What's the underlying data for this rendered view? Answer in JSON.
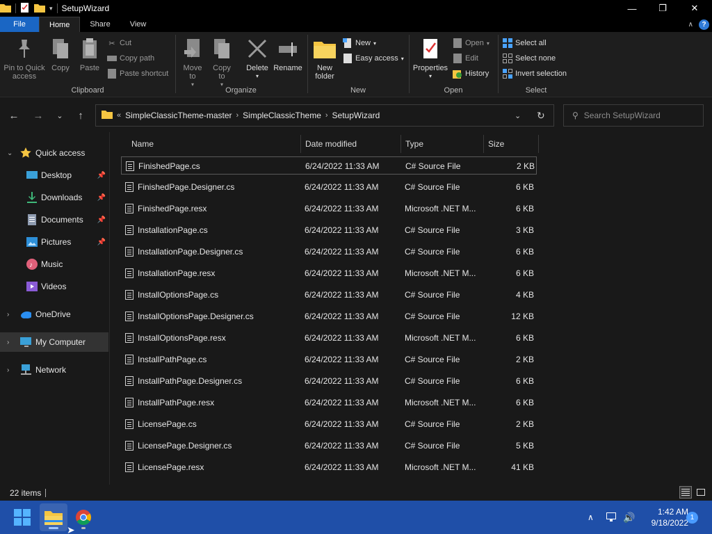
{
  "window": {
    "title": "SetupWizard",
    "controls": {
      "minimize": "—",
      "maximize": "❐",
      "close": "✕"
    }
  },
  "ribbon_tabs": [
    "File",
    "Home",
    "Share",
    "View"
  ],
  "ribbon": {
    "clipboard": {
      "label": "Clipboard",
      "pin": "Pin to Quick access",
      "copy": "Copy",
      "paste": "Paste",
      "cut": "Cut",
      "copy_path": "Copy path",
      "paste_shortcut": "Paste shortcut"
    },
    "organize": {
      "label": "Organize",
      "move_to": "Move to",
      "copy_to": "Copy to",
      "delete": "Delete",
      "rename": "Rename"
    },
    "new": {
      "label": "New",
      "new_folder": "New folder",
      "new_item": "New",
      "easy_access": "Easy access"
    },
    "open": {
      "label": "Open",
      "properties": "Properties",
      "open": "Open",
      "edit": "Edit",
      "history": "History"
    },
    "select": {
      "label": "Select",
      "select_all": "Select all",
      "select_none": "Select none",
      "invert_selection": "Invert selection"
    }
  },
  "address": {
    "overflow": "«",
    "crumbs": [
      "SimpleClassicTheme-master",
      "SimpleClassicTheme",
      "SetupWizard"
    ],
    "search_placeholder": "Search SetupWizard"
  },
  "nav_pane": {
    "quick_access": "Quick access",
    "items": [
      "Desktop",
      "Downloads",
      "Documents",
      "Pictures",
      "Music",
      "Videos"
    ],
    "onedrive": "OneDrive",
    "my_computer": "My Computer",
    "network": "Network"
  },
  "columns": {
    "name": "Name",
    "date": "Date modified",
    "type": "Type",
    "size": "Size"
  },
  "files": [
    {
      "name": "FinishedPage.cs",
      "date": "6/24/2022 11:33 AM",
      "type": "C# Source File",
      "size": "2 KB"
    },
    {
      "name": "FinishedPage.Designer.cs",
      "date": "6/24/2022 11:33 AM",
      "type": "C# Source File",
      "size": "6 KB"
    },
    {
      "name": "FinishedPage.resx",
      "date": "6/24/2022 11:33 AM",
      "type": "Microsoft .NET M...",
      "size": "6 KB"
    },
    {
      "name": "InstallationPage.cs",
      "date": "6/24/2022 11:33 AM",
      "type": "C# Source File",
      "size": "3 KB"
    },
    {
      "name": "InstallationPage.Designer.cs",
      "date": "6/24/2022 11:33 AM",
      "type": "C# Source File",
      "size": "6 KB"
    },
    {
      "name": "InstallationPage.resx",
      "date": "6/24/2022 11:33 AM",
      "type": "Microsoft .NET M...",
      "size": "6 KB"
    },
    {
      "name": "InstallOptionsPage.cs",
      "date": "6/24/2022 11:33 AM",
      "type": "C# Source File",
      "size": "4 KB"
    },
    {
      "name": "InstallOptionsPage.Designer.cs",
      "date": "6/24/2022 11:33 AM",
      "type": "C# Source File",
      "size": "12 KB"
    },
    {
      "name": "InstallOptionsPage.resx",
      "date": "6/24/2022 11:33 AM",
      "type": "Microsoft .NET M...",
      "size": "6 KB"
    },
    {
      "name": "InstallPathPage.cs",
      "date": "6/24/2022 11:33 AM",
      "type": "C# Source File",
      "size": "2 KB"
    },
    {
      "name": "InstallPathPage.Designer.cs",
      "date": "6/24/2022 11:33 AM",
      "type": "C# Source File",
      "size": "6 KB"
    },
    {
      "name": "InstallPathPage.resx",
      "date": "6/24/2022 11:33 AM",
      "type": "Microsoft .NET M...",
      "size": "6 KB"
    },
    {
      "name": "LicensePage.cs",
      "date": "6/24/2022 11:33 AM",
      "type": "C# Source File",
      "size": "2 KB"
    },
    {
      "name": "LicensePage.Designer.cs",
      "date": "6/24/2022 11:33 AM",
      "type": "C# Source File",
      "size": "5 KB"
    },
    {
      "name": "LicensePage.resx",
      "date": "6/24/2022 11:33 AM",
      "type": "Microsoft .NET M...",
      "size": "41 KB"
    }
  ],
  "status": {
    "item_count": "22 items"
  },
  "taskbar": {
    "time": "1:42 AM",
    "date": "9/18/2022",
    "notification_count": "1"
  },
  "colors": {
    "accent": "#1a66c4",
    "taskbar": "#1f4fa8",
    "background": "#191919"
  }
}
